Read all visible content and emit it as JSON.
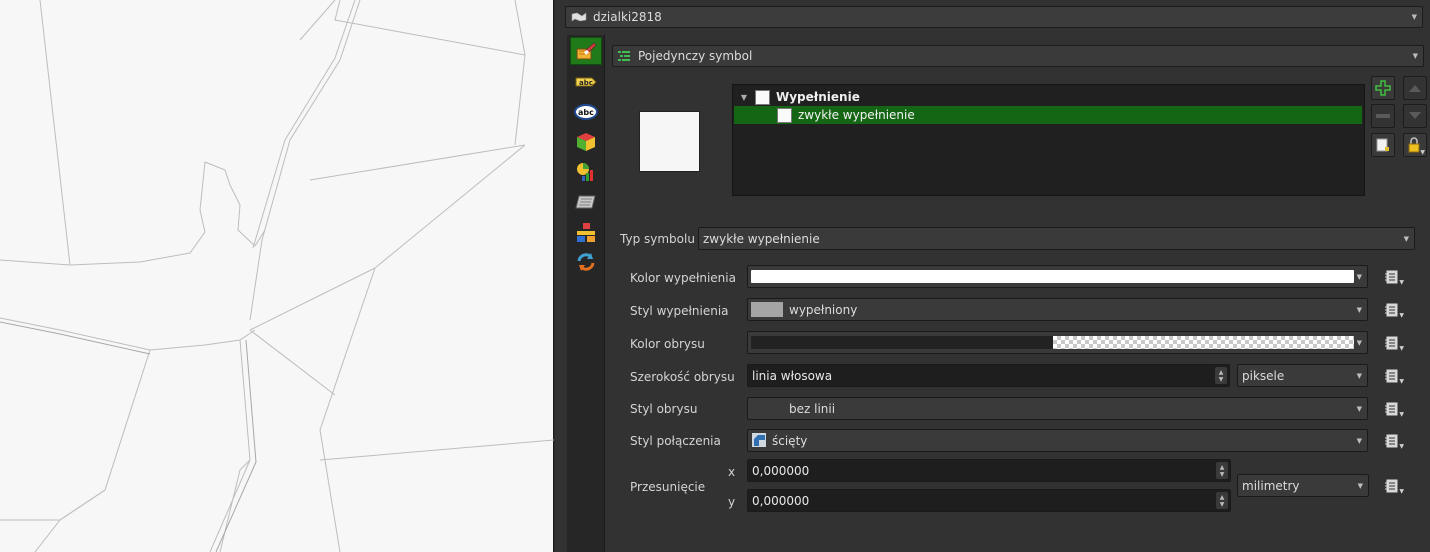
{
  "layer": {
    "name": "dzialki2818"
  },
  "renderer": {
    "label": "Pojedynczy symbol"
  },
  "symbol_tree": {
    "root_label": "Wypełnienie",
    "child_label": "zwykłe wypełnienie"
  },
  "symbol_type": {
    "label": "Typ symbolu",
    "value": "zwykłe wypełnienie"
  },
  "form": {
    "fill_color_label": "Kolor wypełnienia",
    "fill_style_label": "Styl wypełnienia",
    "fill_style_value": "wypełniony",
    "stroke_color_label": "Kolor obrysu",
    "stroke_width_label": "Szerokość obrysu",
    "stroke_width_value": "linia włosowa",
    "stroke_width_unit": "piksele",
    "stroke_style_label": "Styl obrysu",
    "stroke_style_value": "bez linii",
    "join_style_label": "Styl połączenia",
    "join_style_value": "ścięty",
    "offset_label": "Przesunięcie",
    "offset_x_label": "x",
    "offset_x_value": "0,000000",
    "offset_y_label": "y",
    "offset_y_value": "0,000000",
    "offset_unit": "milimetry"
  },
  "colors": {
    "accent_green": "#146614",
    "fill_color": "#ffffff",
    "stroke_color": "#222222",
    "fill_style_swatch": "#a5a5a5"
  },
  "icons": {
    "sidebar": [
      "paintbrush-icon",
      "label-tag-icon",
      "abc-label-icon",
      "3d-cube-icon",
      "diagram-icon",
      "map-tile-icon",
      "rendering-icon",
      "refresh-icon"
    ],
    "tree_buttons": [
      "add-layer-icon",
      "remove-layer-icon",
      "duplicate-layer-icon",
      "lock-icon",
      "move-up-icon",
      "move-down-icon"
    ]
  }
}
